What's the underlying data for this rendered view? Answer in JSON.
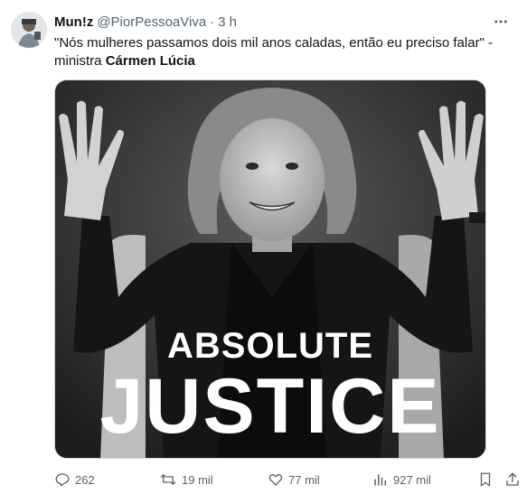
{
  "tweet": {
    "display_name": "Mun!z",
    "handle": "@PiorPessoaViva",
    "separator": "·",
    "time": "3 h",
    "text_main": "\"Nós mulheres passamos dois mil anos caladas, então eu preciso falar\" - ministra ",
    "text_bold": "Cármen Lúcia",
    "more_icon": "more-dots-icon"
  },
  "media": {
    "line1": "ABSOLUTE",
    "line2": "JUSTICE"
  },
  "actions": {
    "replies": "262",
    "retweets": "19 mil",
    "likes": "77 mil",
    "views": "927 mil"
  },
  "colors": {
    "text": "#0f1419",
    "muted": "#536471",
    "border": "#cfd9de"
  }
}
